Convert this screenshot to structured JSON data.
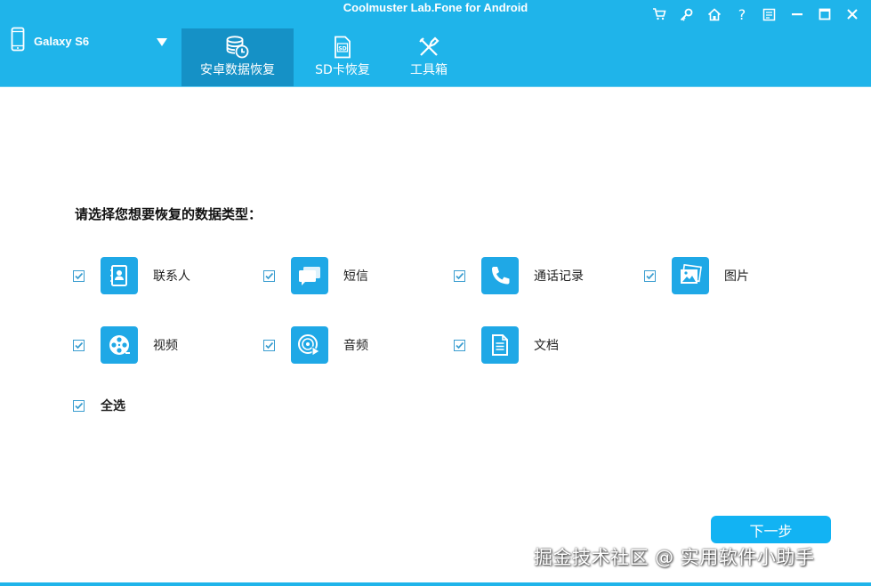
{
  "window": {
    "title": "Coolmuster Lab.Fone for Android",
    "controls": [
      "cart-icon",
      "key-icon",
      "home-icon",
      "help-icon",
      "feedback-icon",
      "minimize-icon",
      "maximize-icon",
      "close-icon"
    ]
  },
  "device": {
    "name": "Galaxy S6",
    "icon": "phone-icon",
    "dropdown_icon": "triangle-down-icon"
  },
  "tabs": [
    {
      "label": "安卓数据恢复",
      "icon": "database-restore-icon",
      "active": true
    },
    {
      "label": "SD卡恢复",
      "icon": "sd-card-icon",
      "active": false
    },
    {
      "label": "工具箱",
      "icon": "tools-icon",
      "active": false
    }
  ],
  "main": {
    "prompt": "请选择您想要恢复的数据类型：",
    "items": [
      {
        "label": "联系人",
        "icon": "contacts-icon",
        "checked": true
      },
      {
        "label": "短信",
        "icon": "messages-icon",
        "checked": true
      },
      {
        "label": "通话记录",
        "icon": "call-log-icon",
        "checked": true
      },
      {
        "label": "图片",
        "icon": "photos-icon",
        "checked": true
      },
      {
        "label": "视频",
        "icon": "video-icon",
        "checked": true
      },
      {
        "label": "音频",
        "icon": "audio-icon",
        "checked": true
      },
      {
        "label": "文档",
        "icon": "document-icon",
        "checked": true
      }
    ],
    "select_all": {
      "label": "全选",
      "checked": true
    }
  },
  "footer": {
    "next_label": "下一步"
  },
  "watermark": "掘金技术社区 @ 实用软件小助手",
  "colors": {
    "brand": "#1fb4ea",
    "active_tab": "#1591c6",
    "tile": "#1fa8e6",
    "next_button": "#12b3f3",
    "checkbox": "#3a9dd0"
  }
}
